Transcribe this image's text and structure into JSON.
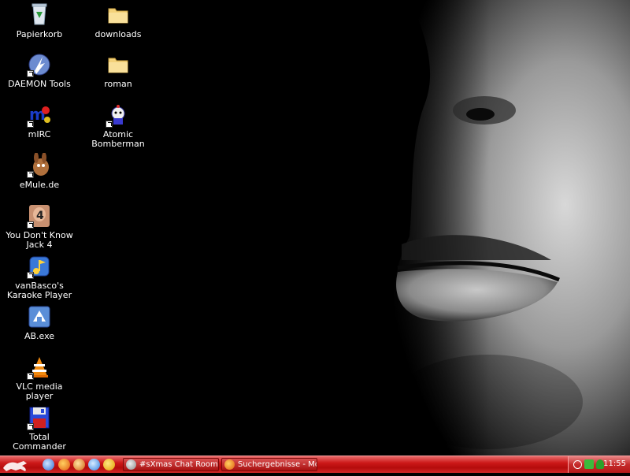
{
  "desktop": {
    "icons": [
      {
        "label": "Papierkorb",
        "icon": "recycle-bin-icon"
      },
      {
        "label": "downloads",
        "icon": "folder-icon"
      },
      {
        "label": "DAEMON Tools",
        "icon": "daemon-tools-icon"
      },
      {
        "label": "roman",
        "icon": "folder-icon"
      },
      {
        "label": "mIRC",
        "icon": "mirc-icon"
      },
      {
        "label": "Atomic Bomberman",
        "icon": "bomberman-icon"
      },
      {
        "label": "eMule.de",
        "icon": "emule-icon"
      },
      {
        "label": "You Don't Know Jack 4",
        "icon": "ydkj-icon"
      },
      {
        "label": "vanBasco's Karaoke Player",
        "icon": "karaoke-icon"
      },
      {
        "label": "AB.exe",
        "icon": "ab-exe-icon"
      },
      {
        "label": "VLC media player",
        "icon": "vlc-icon"
      },
      {
        "label": "Total Commander",
        "icon": "total-commander-icon"
      }
    ]
  },
  "taskbar": {
    "tasks": [
      {
        "label": "#sXmas Chat Room (...",
        "icon": "chat-icon"
      },
      {
        "label": "Suchergebnisse - Moz...",
        "icon": "firefox-icon"
      }
    ],
    "clock": "11:55"
  },
  "colors": {
    "taskbar": "#cc1818",
    "desktop": "#000000"
  }
}
